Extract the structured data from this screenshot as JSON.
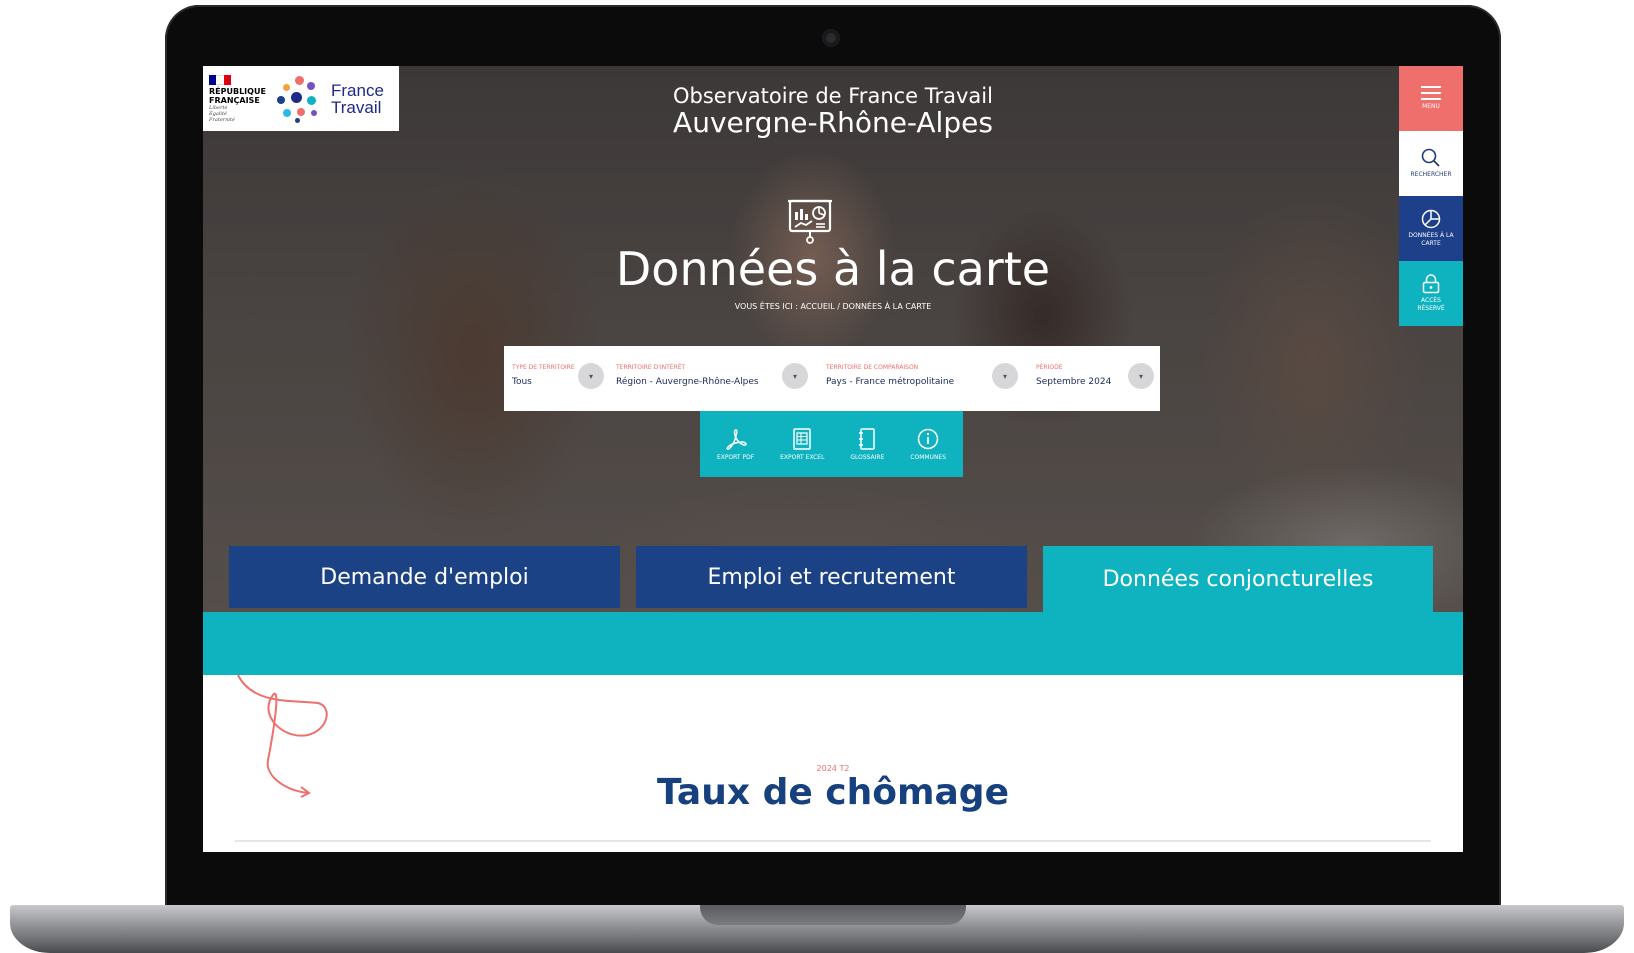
{
  "brand": {
    "republique_line1": "RÉPUBLIQUE",
    "republique_line2": "FRANÇAISE",
    "motto_1": "Liberté",
    "motto_2": "Égalité",
    "motto_3": "Fraternité",
    "name_line1": "France",
    "name_line2": "Travail"
  },
  "header": {
    "subtitle": "Observatoire de France Travail",
    "region": "Auvergne-Rhône-Alpes"
  },
  "side_nav": {
    "menu": "MENU",
    "search": "RECHERCHER",
    "data_line1": "DONNÉES À LA",
    "data_line2": "CARTE",
    "lock_line1": "ACCÈS",
    "lock_line2": "RÉSERVÉ"
  },
  "hero": {
    "title": "Données à la carte",
    "breadcrumb": "VOUS ÊTES ICI : ACCUEIL / DONNÉES À LA CARTE"
  },
  "filters": [
    {
      "caption": "TYPE DE TERRITOIRE",
      "value": "Tous"
    },
    {
      "caption": "TERRITOIRE D'INTÉRÊT",
      "value": "Région - Auvergne-Rhône-Alpes"
    },
    {
      "caption": "TERRITOIRE DE COMPARAISON",
      "value": "Pays - France métropolitaine"
    },
    {
      "caption": "PÉRIODE",
      "value": "Septembre 2024"
    }
  ],
  "toolbar": {
    "pdf": "EXPORT PDF",
    "excel": "EXPORT EXCEL",
    "glossary": "GLOSSAIRE",
    "communes": "COMMUNES"
  },
  "tabs": {
    "demand": "Demande d'emploi",
    "emploi": "Emploi et recrutement",
    "conj": "Données conjoncturelles"
  },
  "section": {
    "period": "2024 T2",
    "title": "Taux de chômage"
  },
  "colors": {
    "navy": "#1c4286",
    "teal": "#0fb3c0",
    "coral": "#ee6f6c",
    "title_blue": "#17407e"
  },
  "icons": {
    "menu": "hamburger-icon",
    "search": "search-icon",
    "data": "pie-chart-icon",
    "lock": "lock-icon",
    "pdf": "pdf-icon",
    "excel": "spreadsheet-icon",
    "glossary": "book-icon",
    "communes": "info-icon"
  }
}
